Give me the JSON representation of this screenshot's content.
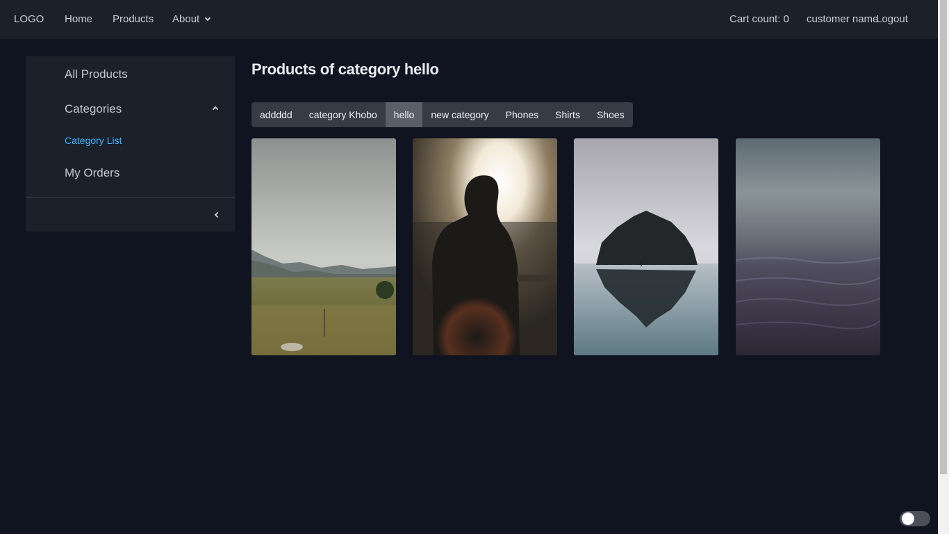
{
  "header": {
    "logo": "LOGO",
    "nav": {
      "home": "Home",
      "products": "Products",
      "about": "About"
    },
    "cart": "Cart count: 0",
    "user": "customer name",
    "logout": "Logout"
  },
  "sidebar": {
    "all_products": "All Products",
    "categories": "Categories",
    "category_list": "Category List",
    "my_orders": "My Orders"
  },
  "main": {
    "title": "Products of category hello",
    "tabs": [
      "addddd",
      "category Khobo",
      "hello",
      "new category",
      "Phones",
      "Shirts",
      "Shoes"
    ],
    "active_tab": "hello",
    "products": [
      {
        "image": "landscape-meadow-photo"
      },
      {
        "image": "person-silhouette-sunset-photo"
      },
      {
        "image": "sea-rock-reflection-photo"
      },
      {
        "image": "misty-ocean-photo"
      }
    ]
  },
  "colors": {
    "background": "#101420",
    "panel": "#1b202b",
    "accent": "#3cb6ff",
    "tab_bg": "#363b45",
    "tab_active": "#5a5f68"
  },
  "theme_toggle": {
    "state": "off"
  }
}
